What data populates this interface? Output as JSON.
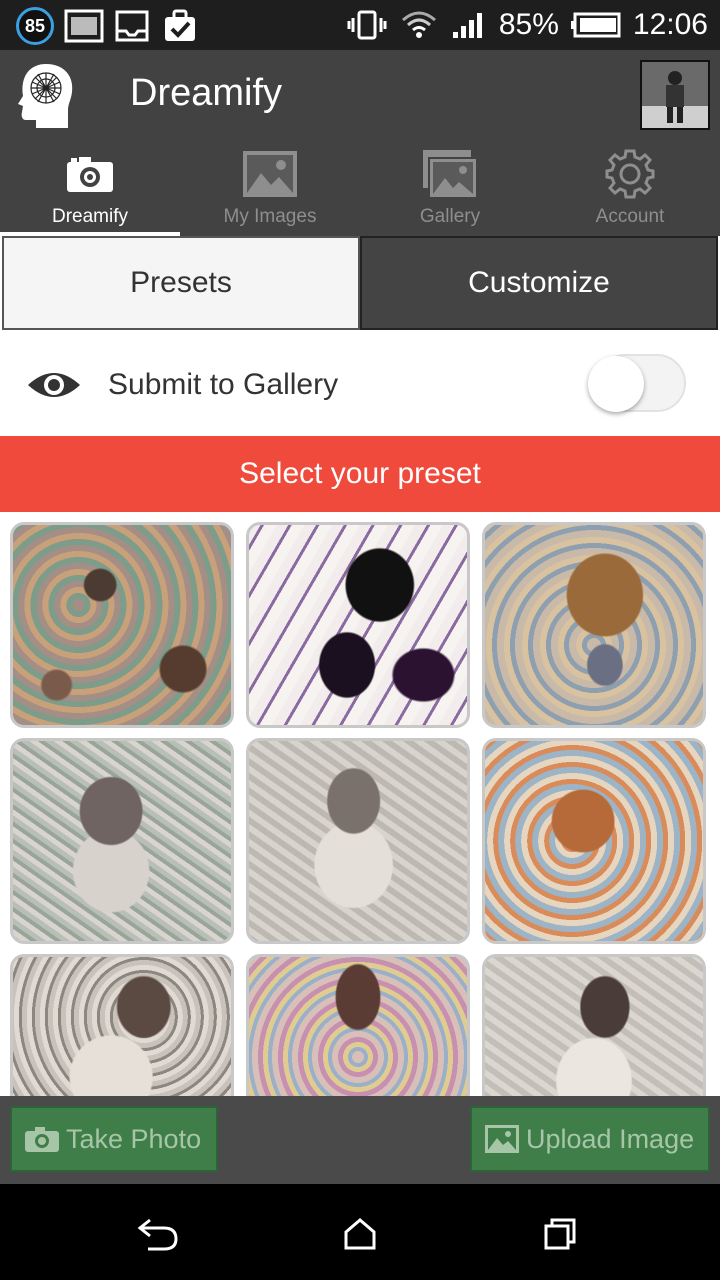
{
  "status_bar": {
    "notification_badge": "85",
    "battery": "85%",
    "time": "12:06"
  },
  "app_bar": {
    "title": "Dreamify"
  },
  "tabs": [
    {
      "label": "Dreamify",
      "icon": "camera-icon",
      "active": true
    },
    {
      "label": "My Images",
      "icon": "image-icon",
      "active": false
    },
    {
      "label": "Gallery",
      "icon": "gallery-icon",
      "active": false
    },
    {
      "label": "Account",
      "icon": "gear-icon",
      "active": false
    }
  ],
  "segmented": {
    "presets_label": "Presets",
    "customize_label": "Customize",
    "selected": "Customize"
  },
  "submit_row": {
    "label": "Submit to Gallery",
    "toggle_on": false
  },
  "banner": {
    "text": "Select your preset",
    "color": "#ef4a3b"
  },
  "presets": {
    "count_visible": 9
  },
  "actions": {
    "take_photo_label": "Take Photo",
    "upload_image_label": "Upload Image",
    "button_color": "#3f7d49"
  },
  "nav_bar": {
    "back": "back-icon",
    "home": "home-icon",
    "recents": "recents-icon"
  }
}
